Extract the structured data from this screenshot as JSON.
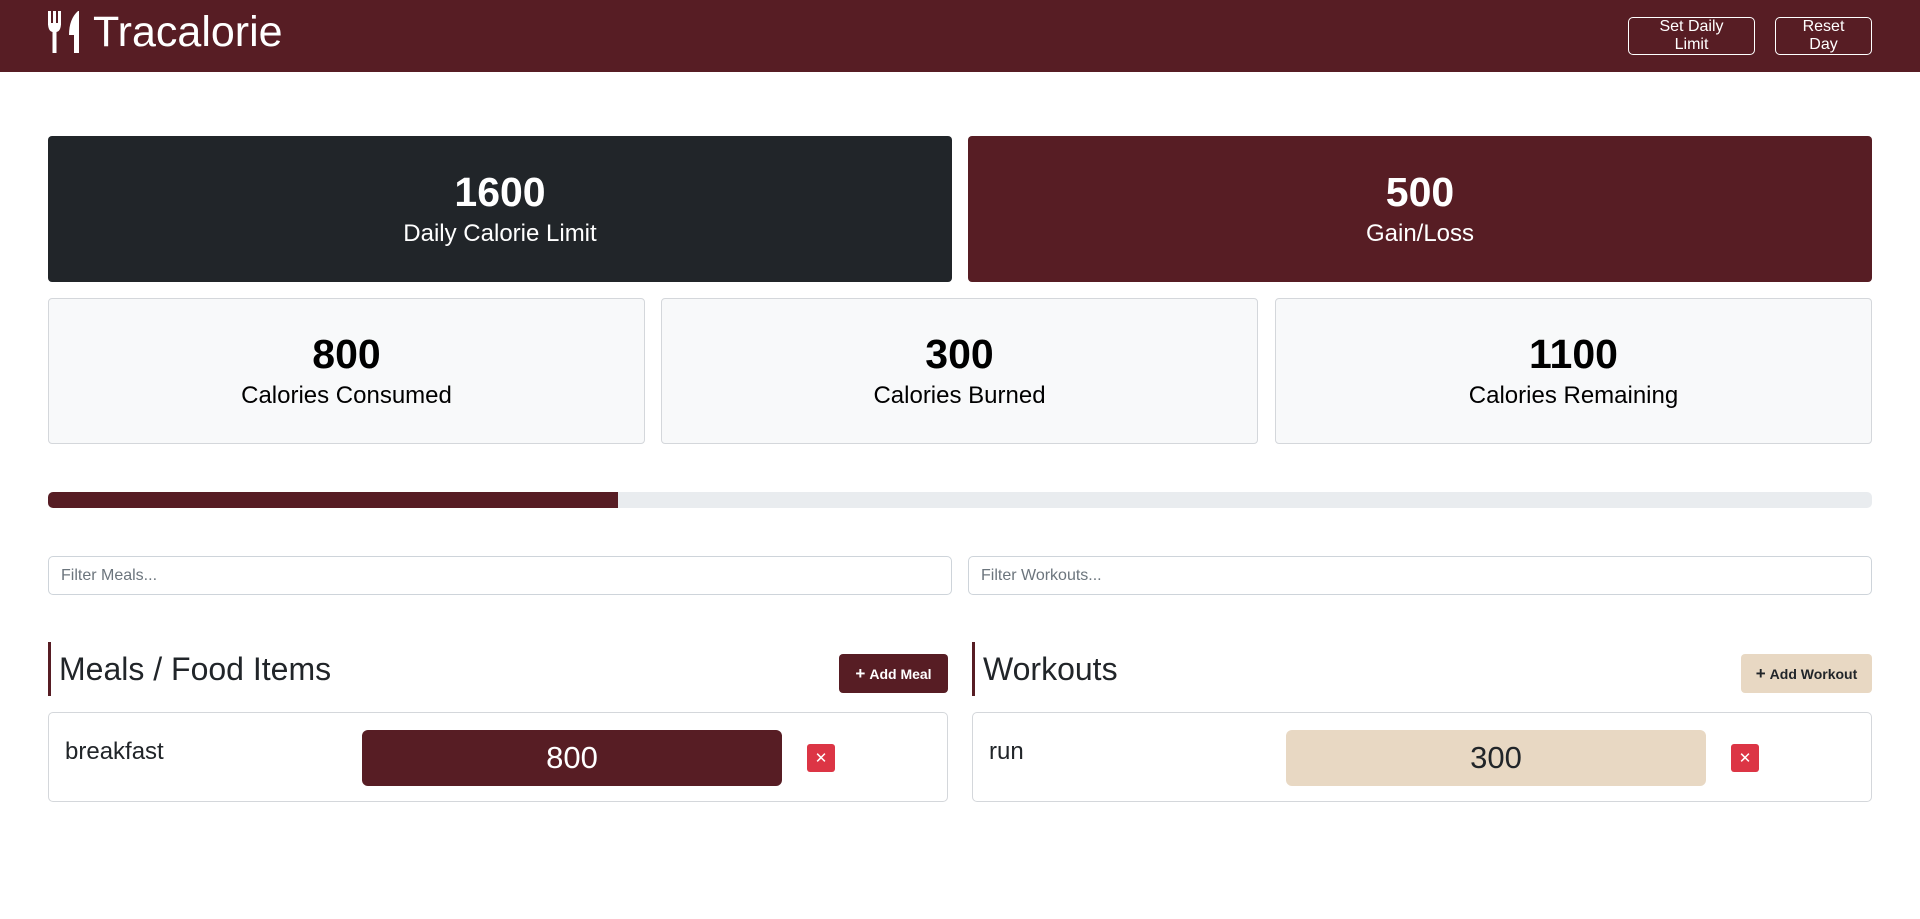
{
  "app": {
    "title": "Tracalorie",
    "icon": "utensils-icon"
  },
  "navbar": {
    "set_limit_label": "Set Daily Limit",
    "reset_label": "Reset Day"
  },
  "stats": {
    "daily_limit": {
      "value": "1600",
      "label": "Daily Calorie Limit"
    },
    "gain_loss": {
      "value": "500",
      "label": "Gain/Loss"
    },
    "consumed": {
      "value": "800",
      "label": "Calories Consumed"
    },
    "burned": {
      "value": "300",
      "label": "Calories Burned"
    },
    "remaining": {
      "value": "1100",
      "label": "Calories Remaining"
    }
  },
  "progress": {
    "percent": 31.25
  },
  "filters": {
    "meals_placeholder": "Filter Meals...",
    "workouts_placeholder": "Filter Workouts..."
  },
  "meals": {
    "title": "Meals / Food Items",
    "add_label": "Add Meal",
    "items": [
      {
        "name": "breakfast",
        "calories": "800"
      }
    ]
  },
  "workouts": {
    "title": "Workouts",
    "add_label": "Add Workout",
    "items": [
      {
        "name": "run",
        "calories": "300"
      }
    ]
  },
  "colors": {
    "brand": "#571d24",
    "dark": "#212529",
    "workout_accent": "#e8d8c3",
    "danger": "#dc3545"
  }
}
